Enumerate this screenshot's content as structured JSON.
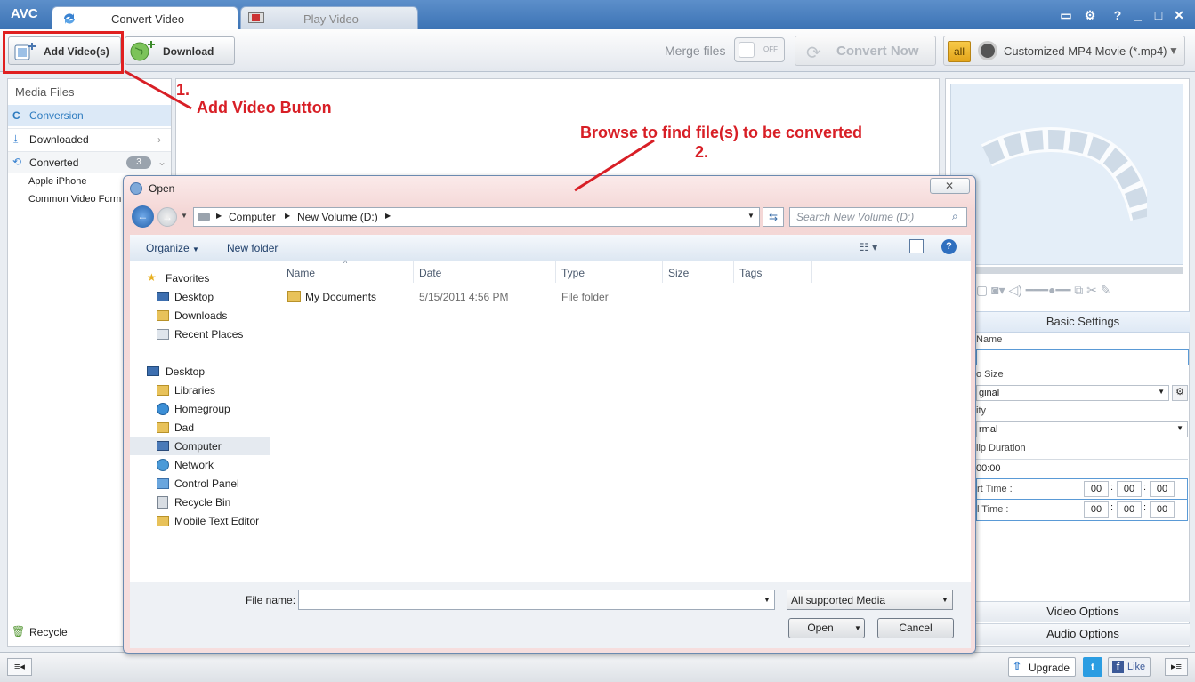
{
  "app": {
    "logo": "AVC",
    "tabs": [
      {
        "label": "Convert Video"
      },
      {
        "label": "Play Video"
      }
    ]
  },
  "toolbar": {
    "add_videos_label": "Add Video(s)",
    "download_label": "Download",
    "merge_label": "Merge files",
    "merge_toggle": "OFF",
    "convert_now_label": "Convert Now",
    "profile_badge": "all",
    "profile_label": "Customized MP4 Movie (*.mp4)"
  },
  "left_panel": {
    "title": "Media Files",
    "items": [
      {
        "label": "Conversion"
      },
      {
        "label": "Downloaded"
      },
      {
        "label": "Converted",
        "count": "3"
      }
    ],
    "sub_items": [
      {
        "label": "Apple iPhone"
      },
      {
        "label": "Common Video Form"
      }
    ],
    "recycle_label": "Recycle"
  },
  "right_panel": {
    "basic_settings": "Basic Settings",
    "fields": [
      {
        "label": "Name",
        "value": ""
      },
      {
        "label": "o Size",
        "value": "ginal"
      },
      {
        "label": "ity",
        "value": "rmal"
      },
      {
        "label": "lip Duration",
        "value": "00:00"
      }
    ],
    "start_time": {
      "label": "rt Time :",
      "h": "00",
      "m": "00",
      "s": "00"
    },
    "end_time": {
      "label": "l Time :",
      "h": "00",
      "m": "00",
      "s": "00"
    },
    "video_options": "Video Options",
    "audio_options": "Audio Options"
  },
  "bottom_bar": {
    "upgrade_label": "Upgrade",
    "like_label": "Like"
  },
  "annotations": {
    "step1_number": "1.",
    "step1_text": "Add Video Button",
    "step2_text": "Browse to find file(s) to be converted",
    "step2_number": "2."
  },
  "dialog": {
    "title": "Open",
    "breadcrumb": [
      "Computer",
      "New Volume (D:)"
    ],
    "search_placeholder": "Search New Volume (D:)",
    "organize_label": "Organize",
    "new_folder_label": "New folder",
    "nav_favorites": {
      "header": "Favorites",
      "items": [
        {
          "label": "Desktop"
        },
        {
          "label": "Downloads"
        },
        {
          "label": "Recent Places"
        }
      ]
    },
    "nav_desktop": {
      "header": "Desktop",
      "items": [
        {
          "label": "Libraries"
        },
        {
          "label": "Homegroup"
        },
        {
          "label": "Dad"
        },
        {
          "label": "Computer"
        },
        {
          "label": "Network"
        },
        {
          "label": "Control Panel"
        },
        {
          "label": "Recycle Bin"
        },
        {
          "label": "Mobile Text Editor"
        }
      ]
    },
    "columns": {
      "name": "Name",
      "date": "Date",
      "type": "Type",
      "size": "Size",
      "tags": "Tags"
    },
    "files": [
      {
        "name": "My Documents",
        "date": "5/15/2011 4:56 PM",
        "type": "File folder",
        "size": ""
      }
    ],
    "file_name_label": "File name:",
    "file_name_value": "",
    "filter_label": "All supported Media",
    "open_label": "Open",
    "cancel_label": "Cancel"
  },
  "colors": {
    "titlebar": "#3c73b5",
    "annotation": "#d81f26",
    "selection": "#dce9f7"
  }
}
